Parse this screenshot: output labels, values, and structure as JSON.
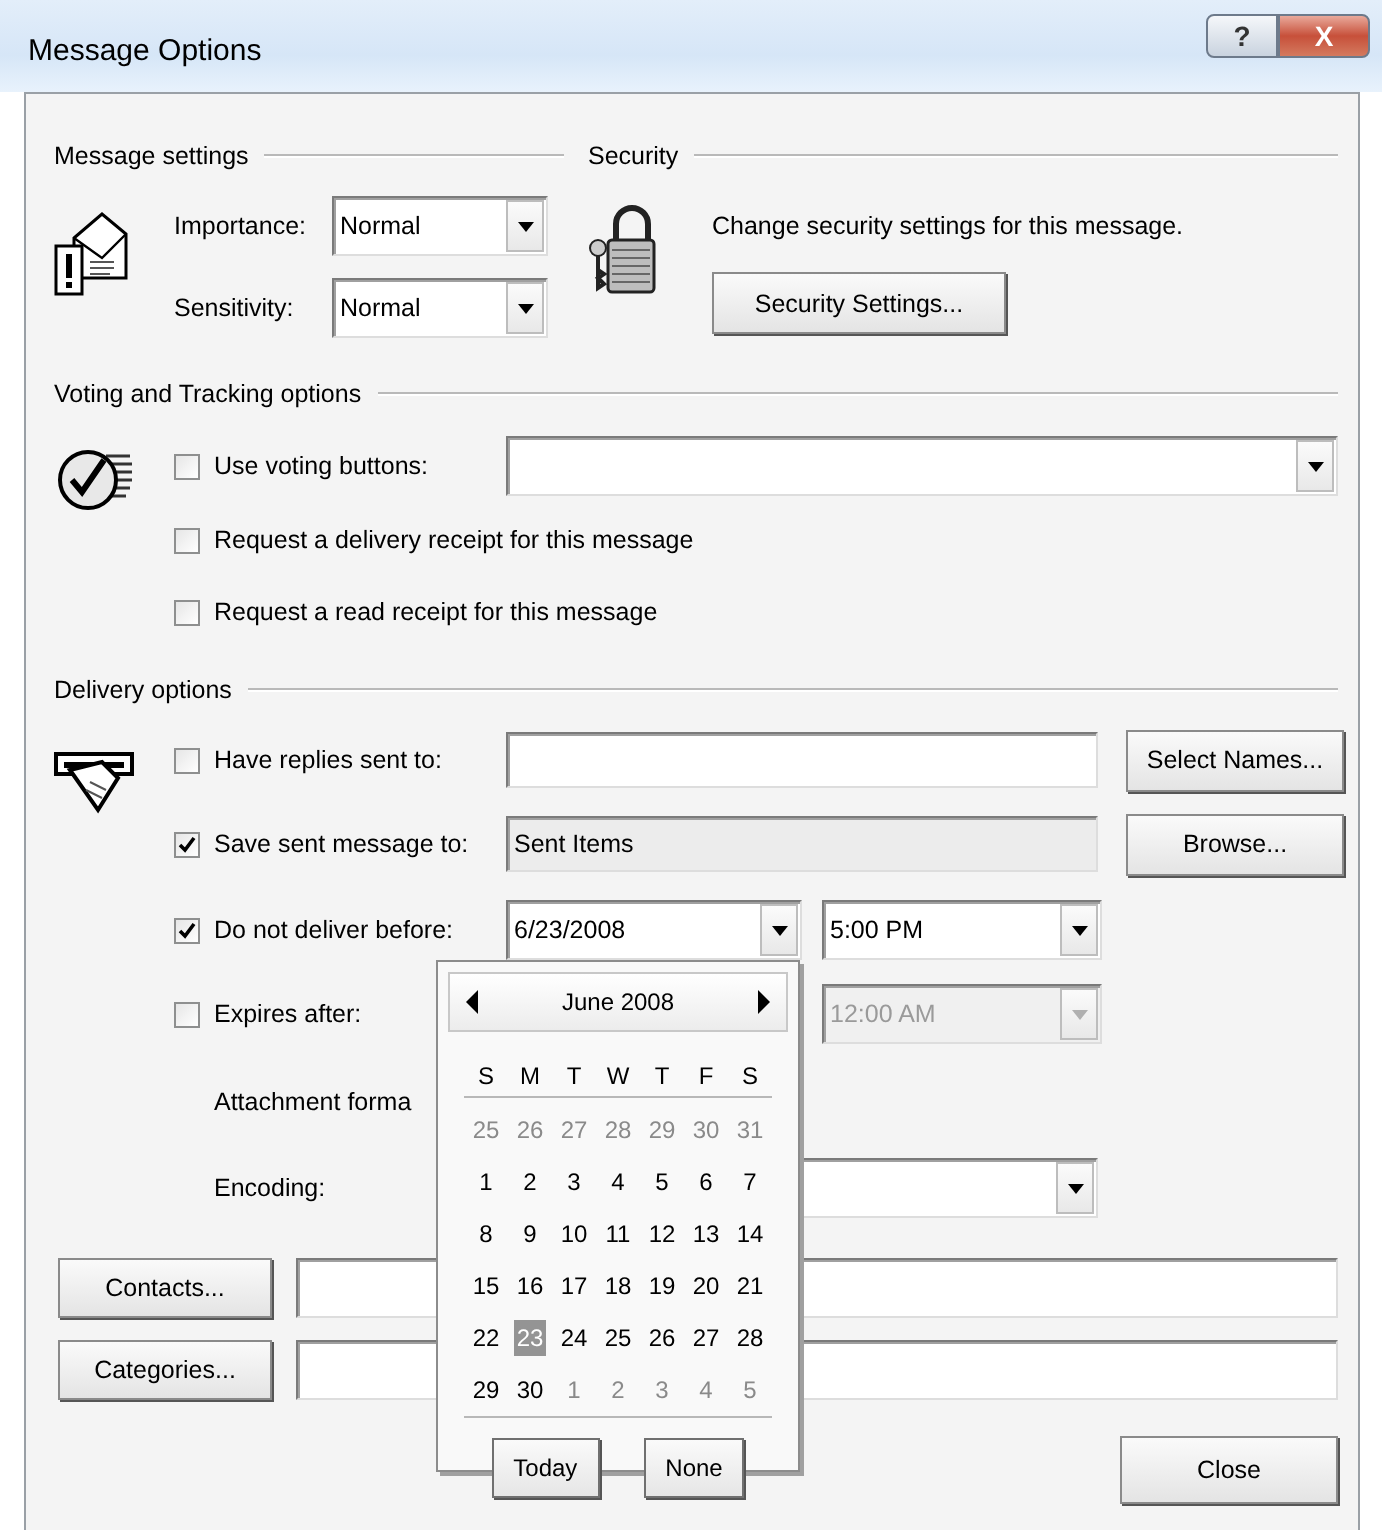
{
  "window": {
    "title": "Message Options",
    "buttons": [
      {
        "kind": "help",
        "label": "?"
      },
      {
        "kind": "close",
        "label": "X"
      }
    ]
  },
  "message_settings": {
    "heading": "Message settings",
    "fields": [
      {
        "label": "Importance:",
        "value": "Normal"
      },
      {
        "label": "Sensitivity:",
        "value": "Normal"
      }
    ]
  },
  "security": {
    "heading": "Security",
    "text": "Change security settings for this message.",
    "button": "Security Settings..."
  },
  "voting_and_tracking": {
    "heading": "Voting and Tracking options",
    "options": [
      {
        "kind": "dropdown",
        "label": "Use voting buttons:",
        "checked": false
      },
      {
        "kind": "plain",
        "label": "Request a delivery receipt for this message",
        "checked": false
      },
      {
        "kind": "plain",
        "label": "Request a read receipt for this message",
        "checked": false
      }
    ]
  },
  "delivery_options": {
    "heading": "Delivery options",
    "rows": [
      {
        "kind": "field_button",
        "label": "Have replies sent to:",
        "checked": false,
        "readonly": false,
        "button": "Select Names..."
      },
      {
        "kind": "field_button",
        "label": "Save sent message to:",
        "checked": true,
        "value": "Sent Items",
        "readonly": true,
        "button": "Browse..."
      },
      {
        "kind": "datetime",
        "label": "Do not deliver before:",
        "checked": true,
        "date": "6/23/2008",
        "time": "5:00 PM",
        "disabled": false
      },
      {
        "kind": "datetime",
        "label": "Expires after:",
        "checked": false,
        "time": "12:00 AM",
        "disabled": true
      },
      {
        "kind": "label",
        "label": "Attachment forma"
      },
      {
        "kind": "dropdown",
        "label": "Encoding:"
      }
    ]
  },
  "bottom_fields": [
    {
      "button": "Contacts..."
    },
    {
      "button": "Categories..."
    }
  ],
  "close_button": "Close",
  "calendar": {
    "month": "June 2008",
    "weekdays": [
      "S",
      "M",
      "T",
      "W",
      "T",
      "F",
      "S"
    ],
    "weeks": [
      [
        {
          "day": "25",
          "other_month": true,
          "selected": false
        },
        {
          "day": "26",
          "other_month": true,
          "selected": false
        },
        {
          "day": "27",
          "other_month": true,
          "selected": false
        },
        {
          "day": "28",
          "other_month": true,
          "selected": false
        },
        {
          "day": "29",
          "other_month": true,
          "selected": false
        },
        {
          "day": "30",
          "other_month": true,
          "selected": false
        },
        {
          "day": "31",
          "other_month": true,
          "selected": false
        }
      ],
      [
        {
          "day": "1",
          "other_month": false,
          "selected": false
        },
        {
          "day": "2",
          "other_month": false,
          "selected": false
        },
        {
          "day": "3",
          "other_month": false,
          "selected": false
        },
        {
          "day": "4",
          "other_month": false,
          "selected": false
        },
        {
          "day": "5",
          "other_month": false,
          "selected": false
        },
        {
          "day": "6",
          "other_month": false,
          "selected": false
        },
        {
          "day": "7",
          "other_month": false,
          "selected": false
        }
      ],
      [
        {
          "day": "8",
          "other_month": false,
          "selected": false
        },
        {
          "day": "9",
          "other_month": false,
          "selected": false
        },
        {
          "day": "10",
          "other_month": false,
          "selected": false
        },
        {
          "day": "11",
          "other_month": false,
          "selected": false
        },
        {
          "day": "12",
          "other_month": false,
          "selected": false
        },
        {
          "day": "13",
          "other_month": false,
          "selected": false
        },
        {
          "day": "14",
          "other_month": false,
          "selected": false
        }
      ],
      [
        {
          "day": "15",
          "other_month": false,
          "selected": false
        },
        {
          "day": "16",
          "other_month": false,
          "selected": false
        },
        {
          "day": "17",
          "other_month": false,
          "selected": false
        },
        {
          "day": "18",
          "other_month": false,
          "selected": false
        },
        {
          "day": "19",
          "other_month": false,
          "selected": false
        },
        {
          "day": "20",
          "other_month": false,
          "selected": false
        },
        {
          "day": "21",
          "other_month": false,
          "selected": false
        }
      ],
      [
        {
          "day": "22",
          "other_month": false,
          "selected": false
        },
        {
          "day": "23",
          "other_month": false,
          "selected": true
        },
        {
          "day": "24",
          "other_month": false,
          "selected": false
        },
        {
          "day": "25",
          "other_month": false,
          "selected": false
        },
        {
          "day": "26",
          "other_month": false,
          "selected": false
        },
        {
          "day": "27",
          "other_month": false,
          "selected": false
        },
        {
          "day": "28",
          "other_month": false,
          "selected": false
        }
      ],
      [
        {
          "day": "29",
          "other_month": false,
          "selected": false
        },
        {
          "day": "30",
          "other_month": false,
          "selected": false
        },
        {
          "day": "1",
          "other_month": true,
          "selected": false
        },
        {
          "day": "2",
          "other_month": true,
          "selected": false
        },
        {
          "day": "3",
          "other_month": true,
          "selected": false
        },
        {
          "day": "4",
          "other_month": true,
          "selected": false
        },
        {
          "day": "5",
          "other_month": true,
          "selected": false
        }
      ]
    ],
    "buttons": [
      "Today",
      "None"
    ]
  }
}
